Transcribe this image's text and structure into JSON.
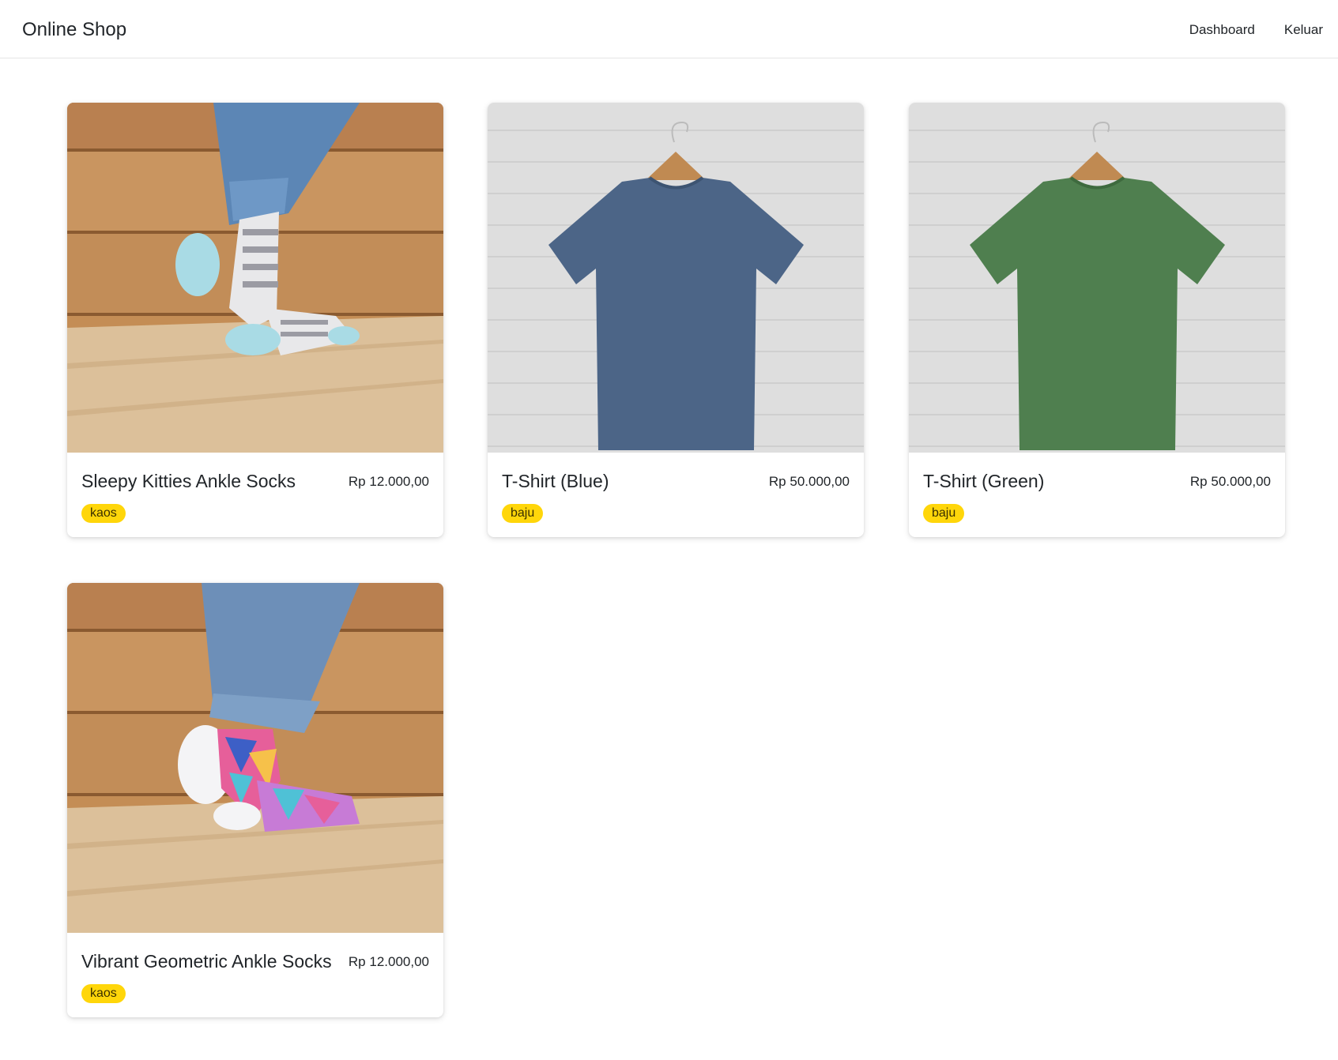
{
  "nav": {
    "brand": "Online Shop",
    "links": [
      "Dashboard",
      "Keluar"
    ]
  },
  "products": [
    {
      "name": "Sleepy Kitties Ankle Socks",
      "price": "Rp 12.000,00",
      "category": "kaos"
    },
    {
      "name": "T-Shirt (Blue)",
      "price": "Rp 50.000,00",
      "category": "baju"
    },
    {
      "name": "T-Shirt (Green)",
      "price": "Rp 50.000,00",
      "category": "baju"
    },
    {
      "name": "Vibrant Geometric Ankle Socks",
      "price": "Rp 12.000,00",
      "category": "kaos"
    }
  ],
  "colors": {
    "badge": "#ffd60a",
    "shirt_blue": "#4c6587",
    "shirt_green": "#4f7f4f",
    "wood": "#c8945c",
    "brick": "#e3e3e3"
  }
}
